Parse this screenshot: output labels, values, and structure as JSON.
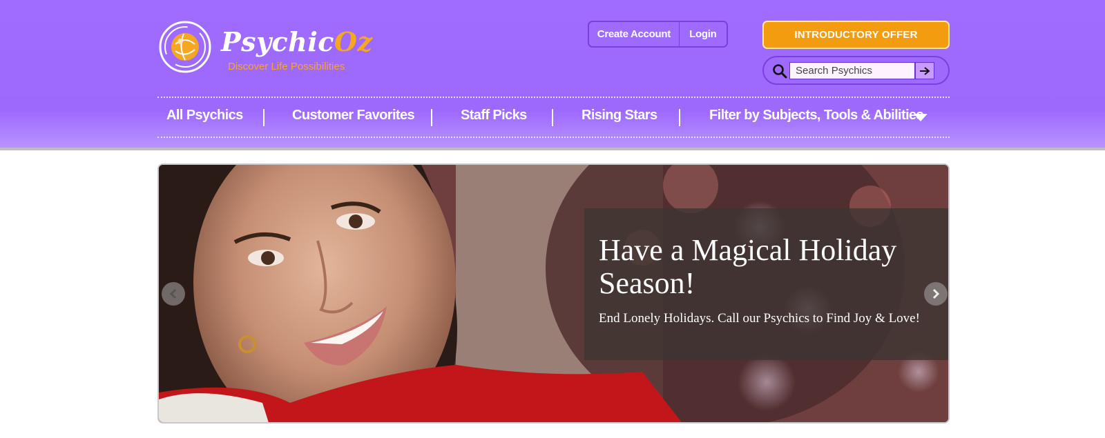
{
  "brand": {
    "name_main": "Psychic",
    "name_accent": "Oz",
    "tagline": "Discover Life Possibilities",
    "logo_icon": "orb-logo-icon"
  },
  "account": {
    "create_label": "Create Account",
    "login_label": "Login"
  },
  "offer": {
    "label": "INTRODUCTORY OFFER"
  },
  "search": {
    "placeholder": "Search Psychics",
    "icon": "search-icon",
    "submit_icon": "arrow-right-icon"
  },
  "nav": {
    "items": [
      {
        "label": "All Psychics"
      },
      {
        "label": "Customer Favorites"
      },
      {
        "label": "Staff Picks"
      },
      {
        "label": "Rising Stars"
      },
      {
        "label": "Filter by Subjects,  Tools & Abilities"
      }
    ],
    "dropdown_icon": "caret-down-icon"
  },
  "hero": {
    "title": "Have a Magical Holiday Season!",
    "subtitle": "End Lonely Holidays. Call our Psychics to Find Joy & Love!",
    "prev_icon": "chevron-left-icon",
    "next_icon": "chevron-right-icon"
  },
  "colors": {
    "header_bg": "#9d69fd",
    "accent_orange": "#f39c0f",
    "border_purple": "#7b3fe0"
  }
}
